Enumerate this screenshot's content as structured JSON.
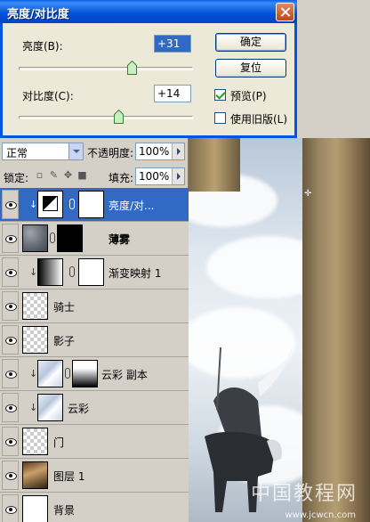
{
  "dialog": {
    "title": "亮度/对比度",
    "brightness_label": "亮度(B):",
    "brightness_value": "+31",
    "brightness_level": 0.65,
    "contrast_label": "对比度(C):",
    "contrast_value": "+14",
    "contrast_level": 0.57,
    "ok_label": "确定",
    "reset_label": "复位",
    "preview_label": "预览(P)",
    "preview_checked": true,
    "legacy_label": "使用旧版(L)",
    "legacy_checked": false
  },
  "layers_panel": {
    "blend_mode": "正常",
    "opacity_label": "不透明度:",
    "opacity_value": "100%",
    "lock_label": "锁定:",
    "fill_label": "填充:",
    "fill_value": "100%",
    "layers": [
      {
        "name": "亮度/对...",
        "selected": true
      },
      {
        "name": "薄雾",
        "bold": true
      },
      {
        "name": "渐变映射 1"
      },
      {
        "name": "骑士"
      },
      {
        "name": "影子"
      },
      {
        "name": "云彩 副本"
      },
      {
        "name": "云彩"
      },
      {
        "name": "门"
      },
      {
        "name": "图层 1"
      },
      {
        "name": "背景"
      }
    ]
  },
  "watermark": {
    "text": "中国教程网",
    "url": "www.jcwcn.com"
  }
}
